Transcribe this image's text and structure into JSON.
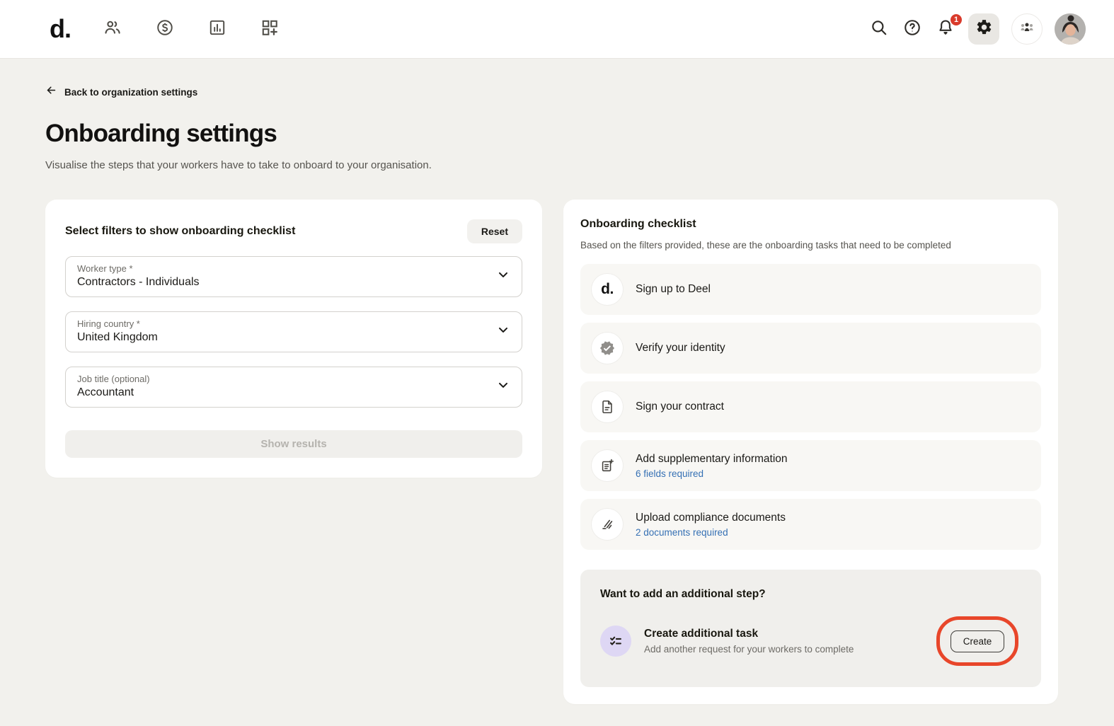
{
  "navbar": {
    "logo": "d.",
    "notification_count": "1"
  },
  "page": {
    "back_link": "Back to organization settings",
    "title": "Onboarding settings",
    "subtitle": "Visualise the steps that your workers have to take to onboard to your organisation."
  },
  "filters_card": {
    "title": "Select filters to show onboarding checklist",
    "reset_label": "Reset",
    "fields": [
      {
        "label": "Worker type *",
        "value": "Contractors - Individuals"
      },
      {
        "label": "Hiring country *",
        "value": "United Kingdom"
      },
      {
        "label": "Job title (optional)",
        "value": "Accountant"
      }
    ],
    "submit_label": "Show results"
  },
  "checklist_card": {
    "title": "Onboarding checklist",
    "subtitle": "Based on the filters provided, these are the onboarding tasks that need to be completed",
    "tasks": [
      {
        "label": "Sign up to Deel",
        "icon": "deel-logo"
      },
      {
        "label": "Verify your identity",
        "icon": "badge-check"
      },
      {
        "label": "Sign your contract",
        "icon": "document"
      },
      {
        "label": "Add supplementary information",
        "link": "6 fields required",
        "icon": "document-plus"
      },
      {
        "label": "Upload compliance documents",
        "link": "2 documents required",
        "icon": "signature"
      }
    ],
    "additional": {
      "heading": "Want to add an additional step?",
      "task_title": "Create additional task",
      "task_subtitle": "Add another request for your workers to complete",
      "create_label": "Create"
    },
    "mini_logo": "d."
  },
  "colors": {
    "page_bg": "#f2f1ed",
    "card_bg": "#ffffff",
    "task_row_bg": "#f8f7f4",
    "additional_box_bg": "#f0efec",
    "link_blue": "#3570b4",
    "badge_red": "#d93a2b",
    "annotation_red": "#e8462a",
    "purple_icon_bg": "#ded7f4",
    "gear_active_bg": "#e9e7e3"
  }
}
